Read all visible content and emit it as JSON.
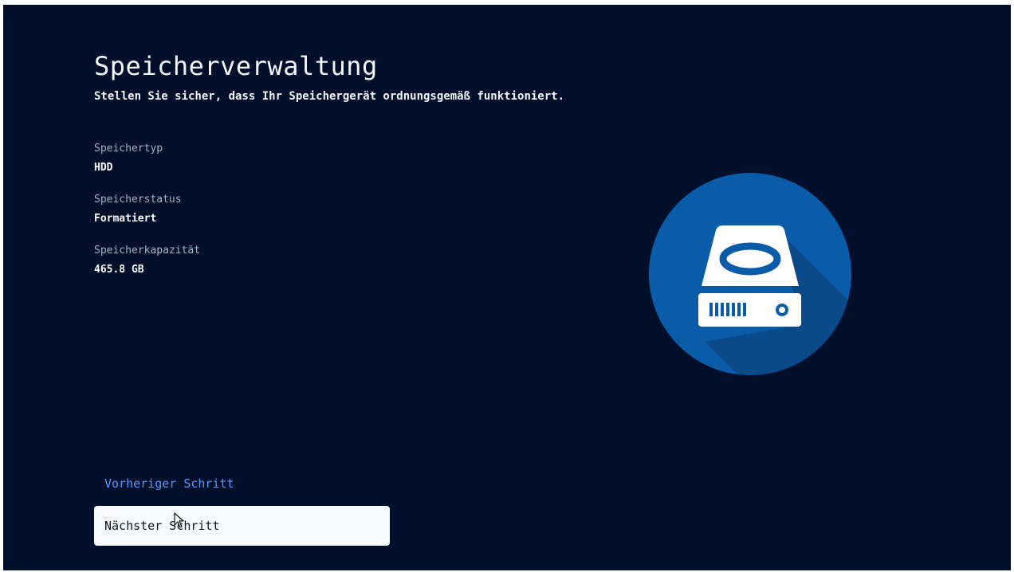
{
  "page": {
    "title": "Speicherverwaltung",
    "subtitle": "Stellen Sie sicher, dass Ihr Speichergerät ordnungsgemäß funktioniert."
  },
  "info": [
    {
      "label": "Speichertyp",
      "value": "HDD"
    },
    {
      "label": "Speicherstatus",
      "value": "Formatiert"
    },
    {
      "label": "Speicherkapazität",
      "value": "465.8 GB"
    }
  ],
  "navigation": {
    "previous_label": "Vorheriger Schritt",
    "next_label": "Nächster Schritt"
  },
  "illustration": {
    "icon": "hard-drive-icon",
    "circle_color": "#0b5ca8",
    "shadow_color": "#0a4a88",
    "drive_color": "#ffffff",
    "detail_color": "#0b5ca8"
  },
  "colors": {
    "background": "#010f2a",
    "link": "#4d9bff",
    "button_background": "#f7fbff"
  }
}
